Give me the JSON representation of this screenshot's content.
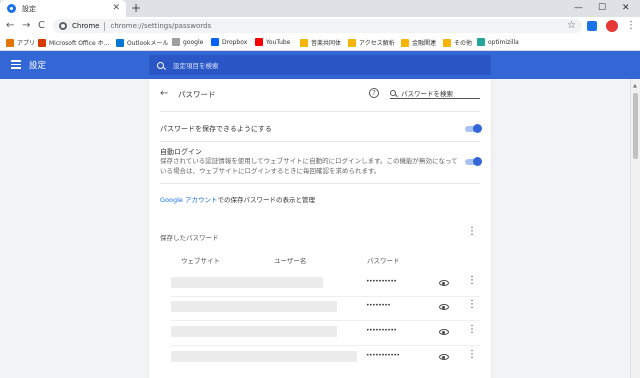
{
  "tab": {
    "title": "設定",
    "close": "✕",
    "new_tab": "+"
  },
  "window": {
    "minimize": "—",
    "maximize": "☐",
    "close": "✕"
  },
  "nav": {
    "back": "←",
    "forward": "→",
    "reload": "C"
  },
  "omnibox": {
    "label": "Chrome",
    "url": "chrome://settings/passwords"
  },
  "bookmarks": [
    {
      "label": "アプリ",
      "color": "#e37400"
    },
    {
      "label": "Microsoft Office ホ…",
      "color": "#d83b01"
    },
    {
      "label": "Outlookメール",
      "color": "#0078d4"
    },
    {
      "label": "google",
      "color": "#9e9e9e"
    },
    {
      "label": "Dropbox",
      "color": "#0061fe"
    },
    {
      "label": "YouTube",
      "color": "#ff0000"
    },
    {
      "label": "音楽共同体",
      "color": "#f4b400"
    },
    {
      "label": "アクセス解析",
      "color": "#f4b400"
    },
    {
      "label": "金融関連",
      "color": "#f4b400"
    },
    {
      "label": "その他",
      "color": "#f4b400"
    },
    {
      "label": "optimizilla",
      "color": "#26a69a"
    }
  ],
  "header": {
    "title": "設定",
    "search_placeholder": "設定項目を検索",
    "accent": "#3367d6"
  },
  "passwords": {
    "title": "パスワード",
    "help": "?",
    "search_placeholder": "パスワードを検索",
    "offer_to_save": {
      "label": "パスワードを保存できるようにする",
      "enabled": true
    },
    "auto_signin": {
      "label": "自動ログイン",
      "description": "保存されている認証情報を使用してウェブサイトに自動的にログインします。この機能が無効になっている場合は、ウェブサイトにログインするときに毎回確認を求められます。",
      "enabled": true
    },
    "google_link": {
      "link": "Google アカウント",
      "rest": "での保存パスワードの表示と管理"
    },
    "saved_title": "保存したパスワード",
    "columns": {
      "website": "ウェブサイト",
      "username": "ユーザー名",
      "password": "パスワード"
    },
    "rows": [
      {
        "password": "••••••••••"
      },
      {
        "password": "••••••••"
      },
      {
        "password": "••••••••••"
      },
      {
        "password": "•••••••••••"
      }
    ]
  }
}
